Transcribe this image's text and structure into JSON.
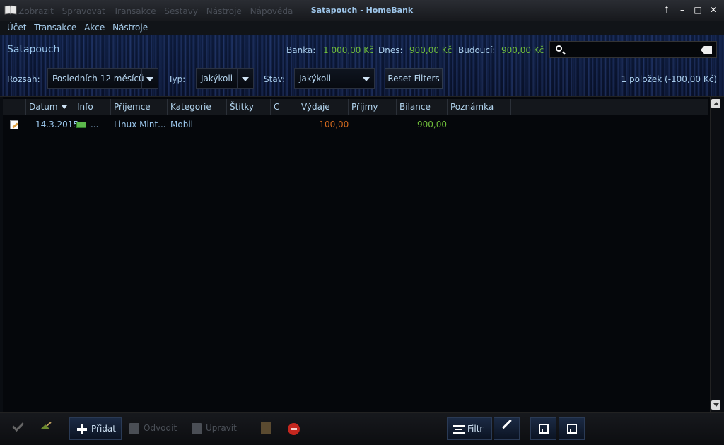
{
  "window": {
    "title": "Satapouch - HomeBank",
    "ghost_menu": [
      "Zobrazit",
      "Spravovat",
      "Transakce",
      "Sestavy",
      "Nástroje",
      "Nápověda"
    ],
    "controls": [
      "↑",
      "–",
      "□",
      "✕"
    ]
  },
  "menubar": [
    "Účet",
    "Transakce",
    "Akce",
    "Nástroje"
  ],
  "header": {
    "account": "Satapouch",
    "banka_label": "Banka:",
    "banka_value": "1 000,00 Kč",
    "dnes_label": "Dnes:",
    "dnes_value": "900,00 Kč",
    "budouci_label": "Budoucí:",
    "budouci_value": "900,00 Kč",
    "search_value": ""
  },
  "filters": {
    "rozsah_label": "Rozsah:",
    "rozsah_value": "Posledních 12 měsíců",
    "typ_label": "Typ:",
    "typ_value": "Jakýkoli",
    "stav_label": "Stav:",
    "stav_value": "Jakýkoli",
    "reset_label": "Reset Filters",
    "count": "1 položek (-100,00 Kč)"
  },
  "columns": [
    "Datum",
    "Info",
    "Příjemce",
    "Kategorie",
    "Štítky",
    "C",
    "Výdaje",
    "Příjmy",
    "Bilance",
    "Poznámka"
  ],
  "rows": [
    {
      "datum": "14.3.2015",
      "info": "...",
      "prijemce": "Linux Mint...",
      "kategorie": "Mobil",
      "vydaje": "-100,00",
      "bilance": "900,00"
    }
  ],
  "toolbar": {
    "pridat": "Přidat",
    "odvodit": "Odvodit",
    "upravit": "Upravit",
    "filtr": "Filtr"
  },
  "colors": {
    "green": "#6fbd3a",
    "expense": "#d2691e",
    "accent": "#9cc8ee"
  }
}
